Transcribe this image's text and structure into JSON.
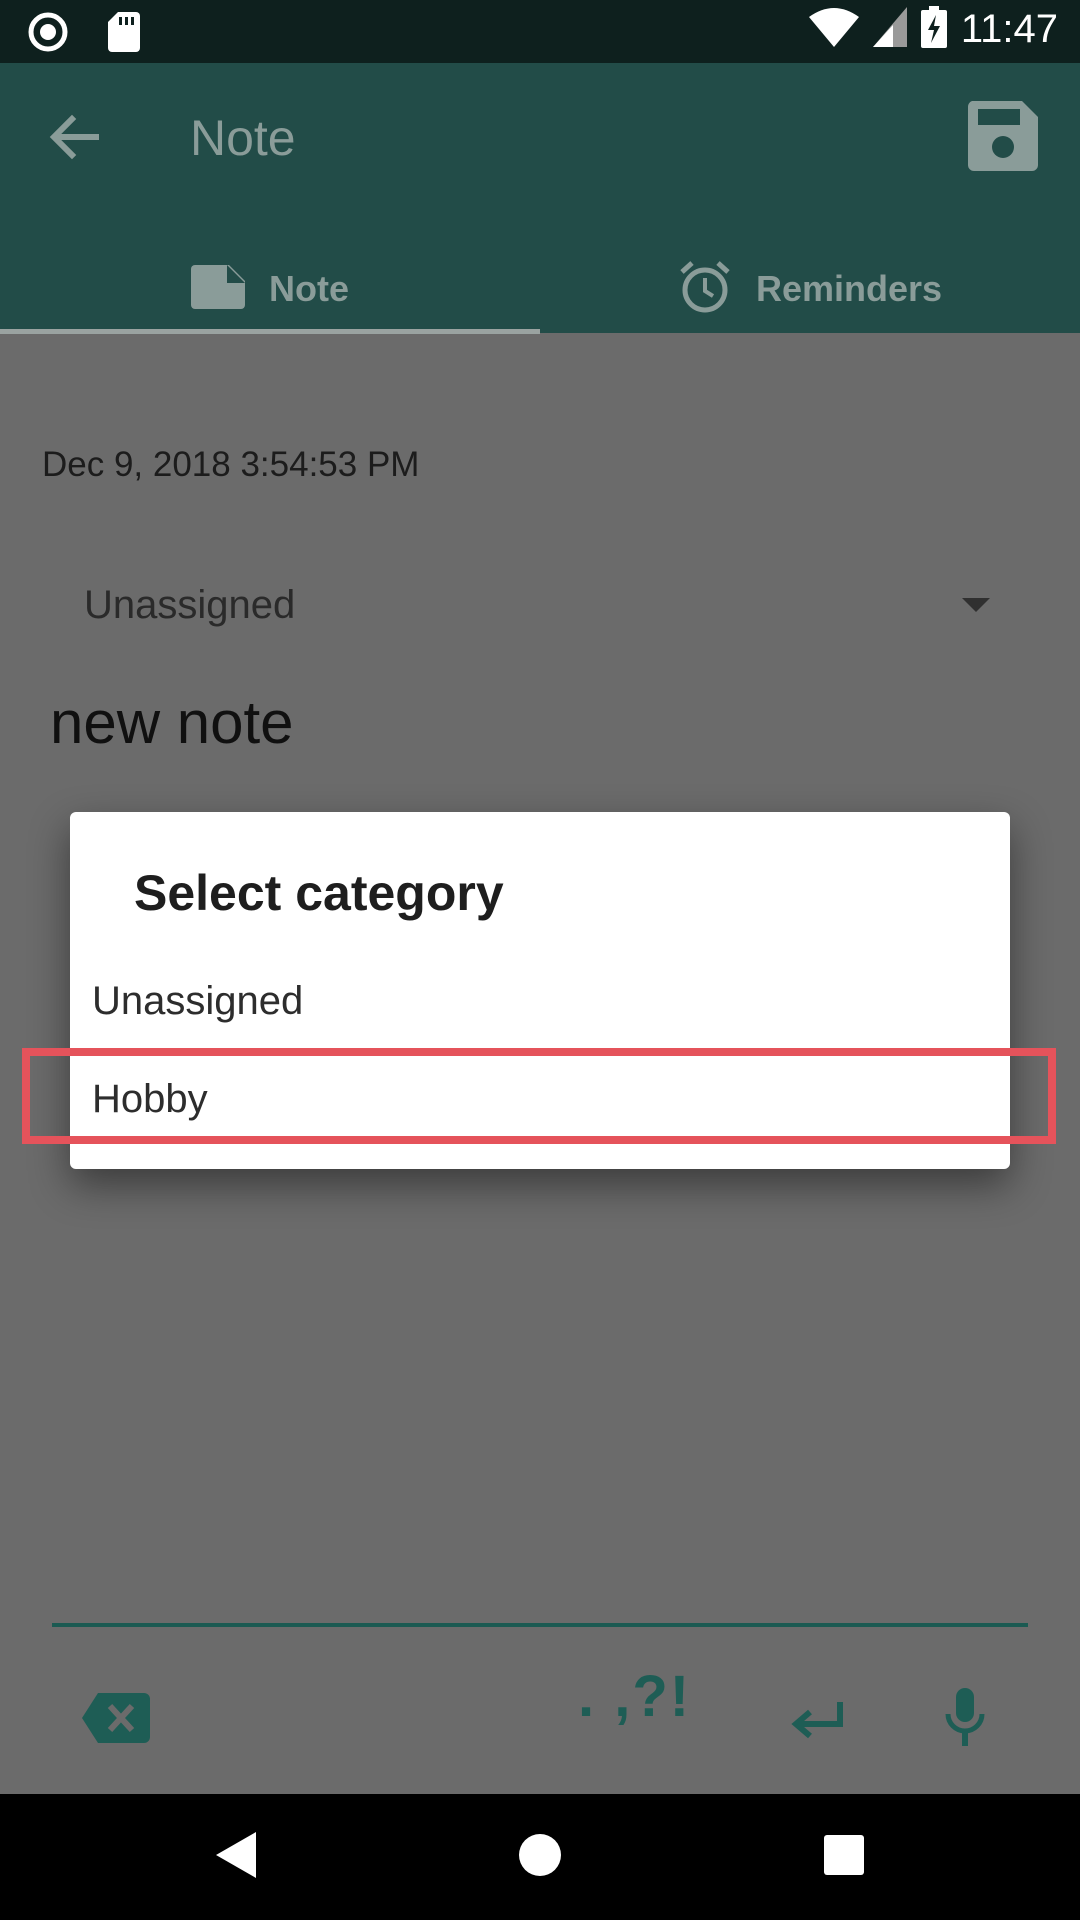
{
  "status_bar": {
    "time": "11:47",
    "icons": [
      "record-icon",
      "sd-card-icon",
      "wifi-icon",
      "signal-icon",
      "battery-charging-icon"
    ]
  },
  "app_bar": {
    "title": "Note",
    "back_icon": "arrow-back-icon",
    "save_icon": "save-icon"
  },
  "tabs": [
    {
      "label": "Note",
      "icon": "note-icon",
      "selected": true
    },
    {
      "label": "Reminders",
      "icon": "alarm-clock-icon",
      "selected": false
    }
  ],
  "note": {
    "date": "Dec 9, 2018 3:54:53 PM",
    "category": "Unassigned",
    "title": "new note"
  },
  "dialog": {
    "title": "Select category",
    "options": [
      "Unassigned",
      "Hobby"
    ],
    "highlighted_option": "Hobby"
  },
  "editor_toolbar": {
    "punctuation": ". ,?!",
    "icons": [
      "backspace-icon",
      "enter-icon",
      "microphone-icon"
    ]
  },
  "nav_bar": {
    "icons": [
      "back-triangle-icon",
      "home-circle-icon",
      "recents-square-icon"
    ]
  },
  "colors": {
    "app_bar": "#224c48",
    "accent": "#1e5d55",
    "highlight": "#e5535b",
    "scrim_background": "#6b6b6b"
  }
}
